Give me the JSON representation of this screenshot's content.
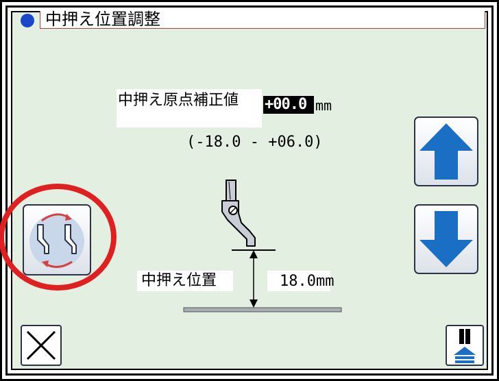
{
  "title": "中押え位置調整",
  "correction": {
    "label": "中押え原点補正値",
    "value": "+00.0",
    "unit": "mm",
    "range": "(-18.0 - +06.0)"
  },
  "position": {
    "label": "中押え位置",
    "value": "18.0mm"
  },
  "icons": {
    "title_marker": "circle-icon",
    "up": "arrow-up-icon",
    "down": "arrow-down-icon",
    "swap": "presser-foot-swap-icon",
    "close": "close-icon",
    "menu": "thread-spool-up-icon"
  },
  "colors": {
    "screen_bg": "#e3efe0",
    "accent_blue": "#1a6fc4",
    "highlight_red": "#e02020"
  }
}
